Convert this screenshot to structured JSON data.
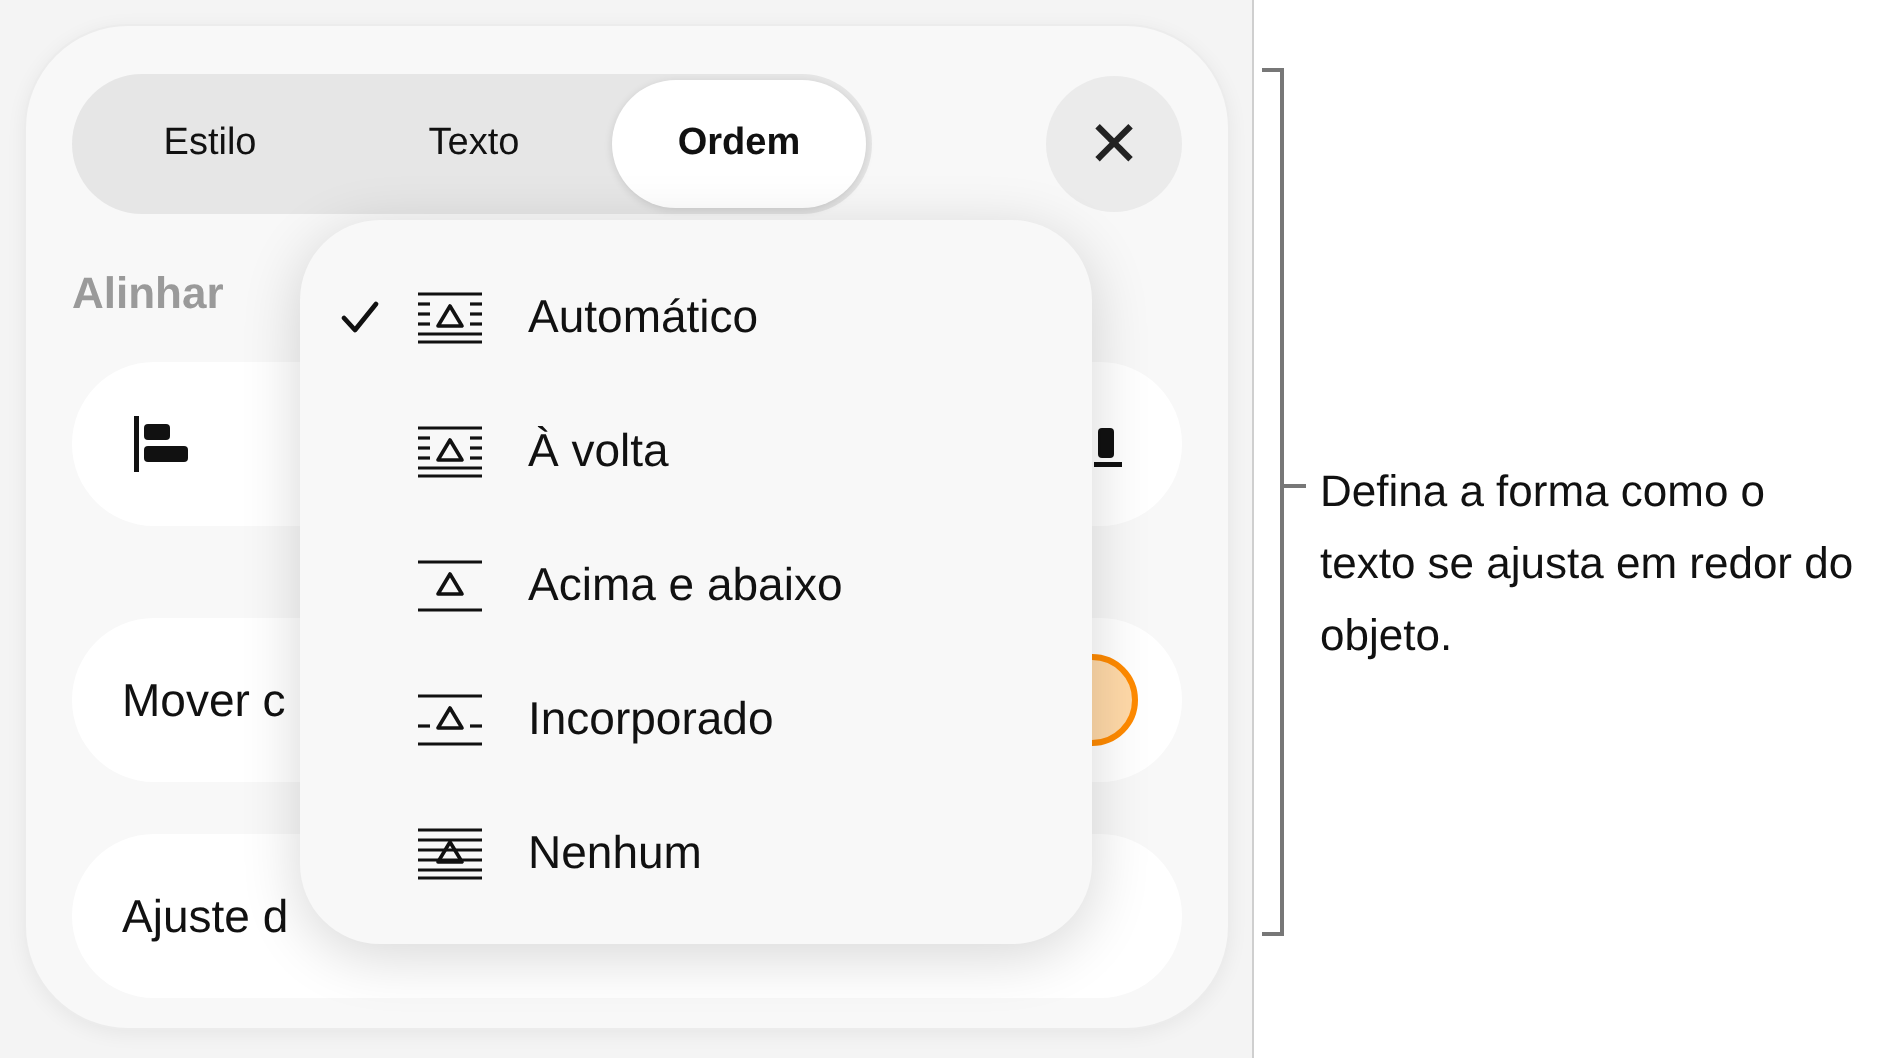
{
  "tabs": [
    {
      "label": "Estilo",
      "selected": false
    },
    {
      "label": "Texto",
      "selected": false
    },
    {
      "label": "Ordem",
      "selected": true
    }
  ],
  "close_button": {
    "glyph": "✕"
  },
  "align_section": {
    "label": "Alinhar"
  },
  "rows": [
    {
      "label": "Mover c",
      "toggle": {
        "on": true
      }
    },
    {
      "label": "Ajuste d"
    }
  ],
  "wrap_menu": {
    "items": [
      {
        "kind": "auto",
        "label": "Automático",
        "selected": true
      },
      {
        "kind": "around",
        "label": "À volta",
        "selected": false
      },
      {
        "kind": "above-below",
        "label": "Acima e abaixo",
        "selected": false
      },
      {
        "kind": "inline",
        "label": "Incorporado",
        "selected": false
      },
      {
        "kind": "none",
        "label": "Nenhum",
        "selected": false
      }
    ]
  },
  "callout": {
    "text": "Defina a forma como o texto se ajusta em redor do objeto."
  }
}
